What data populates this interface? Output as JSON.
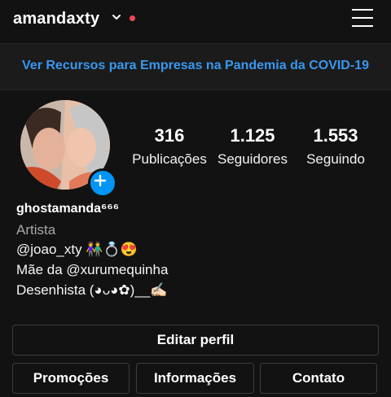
{
  "header": {
    "username": "amandaxty"
  },
  "banner": {
    "text": "Ver Recursos para Empresas na Pandemia da COVID-19"
  },
  "stats": [
    {
      "value": "316",
      "label": "Publicações"
    },
    {
      "value": "1.125",
      "label": "Seguidores"
    },
    {
      "value": "1.553",
      "label": "Seguindo"
    }
  ],
  "profile": {
    "display_name": "ghostamanda⁶⁶⁶",
    "category": "Artista",
    "bio": [
      "@joao_xty 👫💍😍",
      "Mãe da @xurumequinha",
      "Desenhista (◕ᴗ◕✿)__✍🏻"
    ]
  },
  "buttons": {
    "edit_profile": "Editar perfil",
    "promotions": "Promoções",
    "info": "Informações",
    "contact": "Contato"
  },
  "colors": {
    "background": "#121212",
    "link": "#3897f0",
    "notification_dot": "#ed4956",
    "add_button": "#0095f6"
  },
  "icons": [
    "chevron-down-icon",
    "menu-icon",
    "plus-icon"
  ]
}
